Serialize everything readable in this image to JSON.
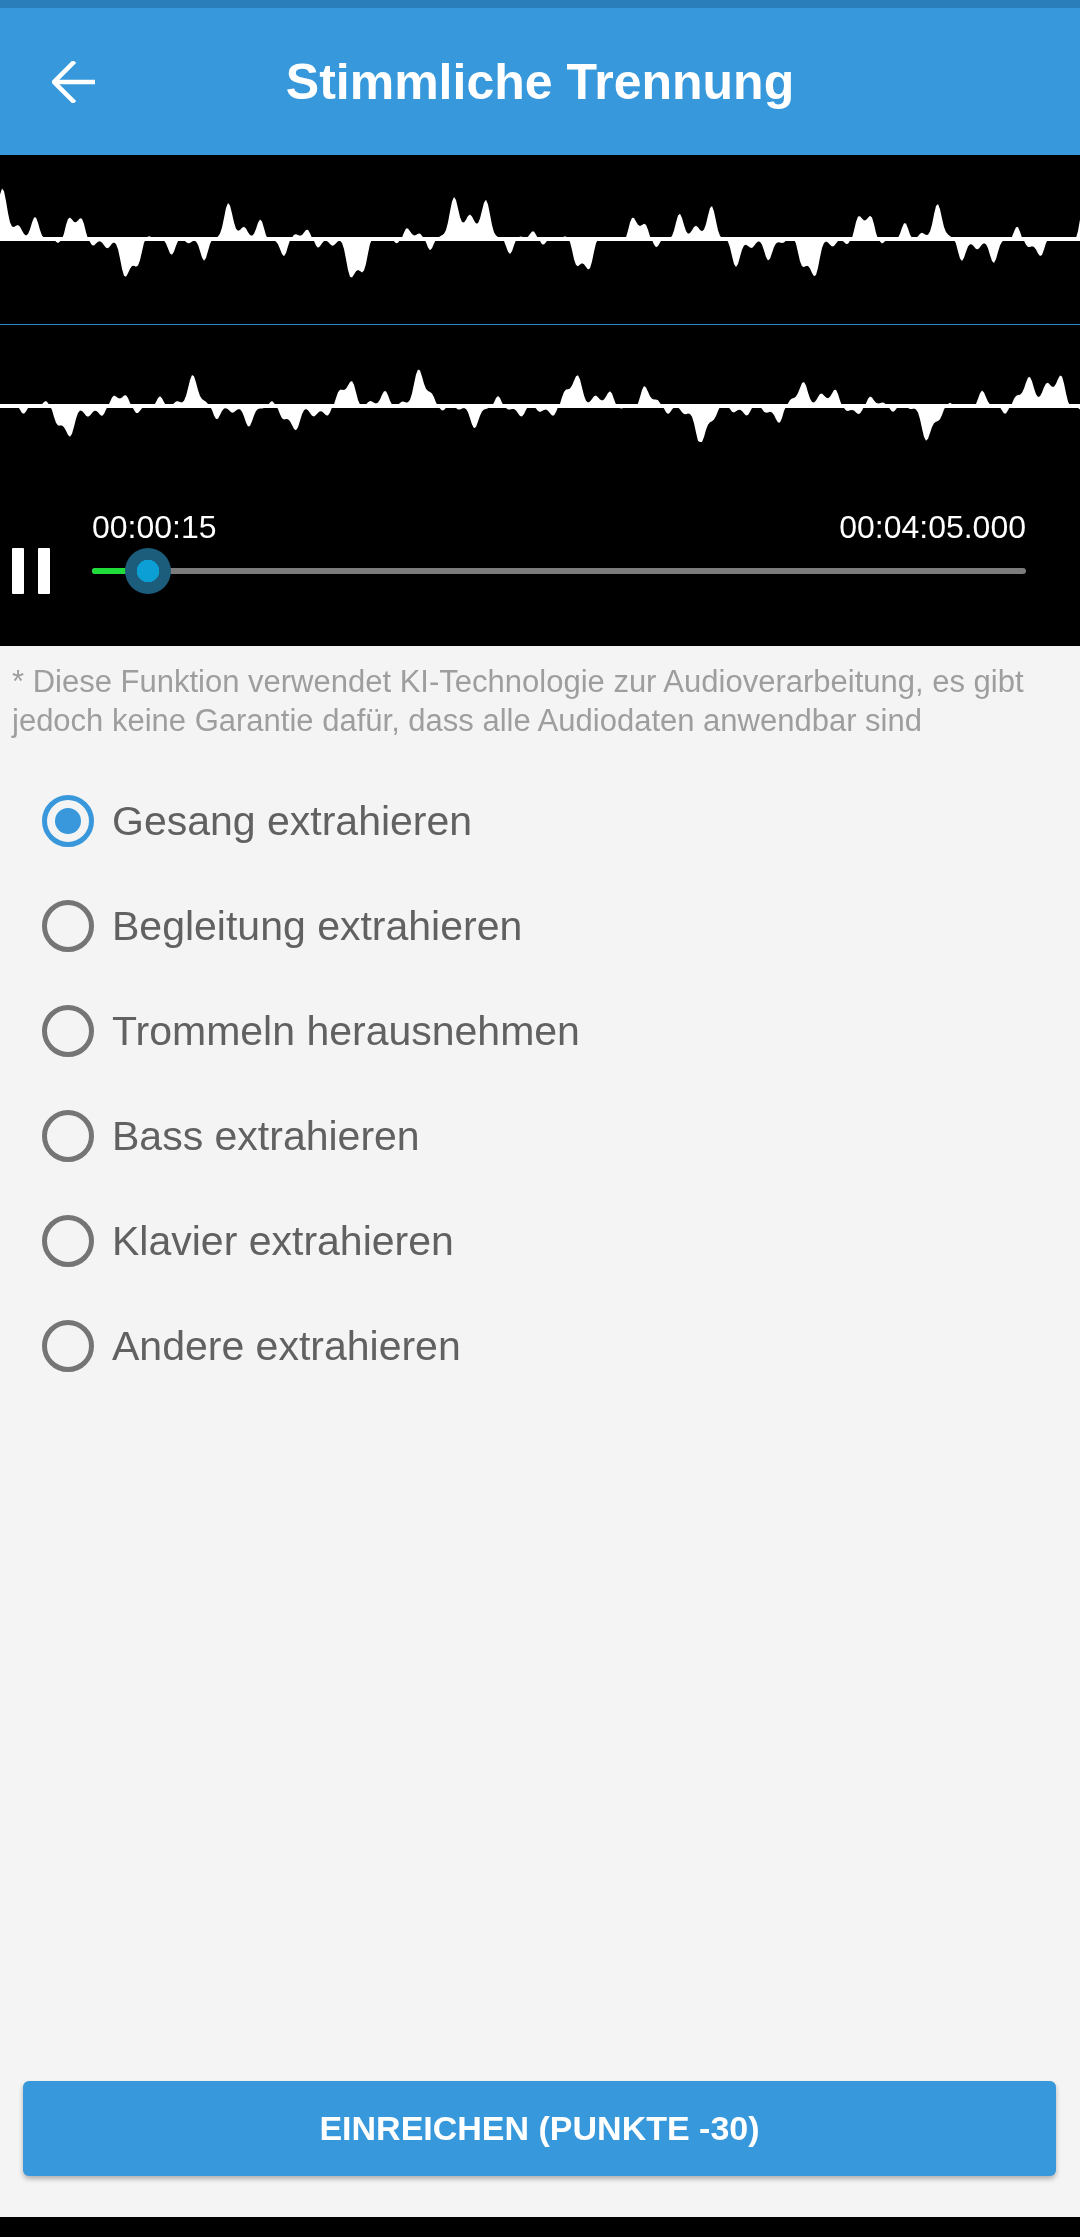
{
  "app_bar": {
    "title": "Stimmliche Trennung"
  },
  "player": {
    "playing": true,
    "current_time": "00:00:15",
    "total_time": "00:04:05.000",
    "level": 0.06
  },
  "notice": "* Diese Funktion verwendet KI-Technologie zur Audioverarbeitung, es gibt jedoch keine Garantie dafür, dass alle Audiodaten anwendbar sind",
  "options": [
    {
      "label": "Gesang extrahieren",
      "selected": true
    },
    {
      "label": "Begleitung extrahieren",
      "selected": false
    },
    {
      "label": "Trommeln herausnehmen",
      "selected": false
    },
    {
      "label": "Bass extrahieren",
      "selected": false
    },
    {
      "label": "Klavier extrahieren",
      "selected": false
    },
    {
      "label": "Andere extrahieren",
      "selected": false
    }
  ],
  "submit_button": {
    "label": "EINREICHEN (PUNKTE -30)"
  }
}
